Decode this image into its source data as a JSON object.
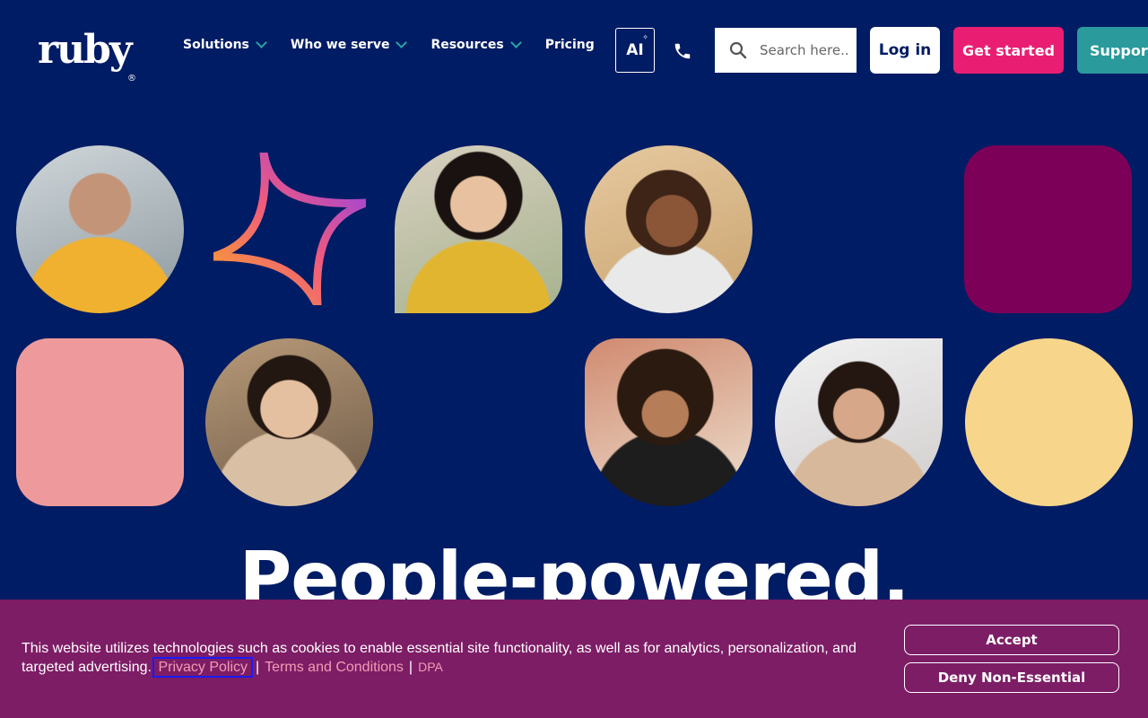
{
  "header": {
    "logo_text": "ruby",
    "logo_mark": "®",
    "nav": [
      {
        "label": "Solutions",
        "has_dropdown": true
      },
      {
        "label": "Who we serve",
        "has_dropdown": true
      },
      {
        "label": "Resources",
        "has_dropdown": true
      },
      {
        "label": "Pricing",
        "has_dropdown": false
      }
    ],
    "ai_label": "AI",
    "search_placeholder": "Search here...",
    "login_label": "Log in",
    "get_started_label": "Get started",
    "support_label": "Support"
  },
  "hero": {
    "headline": "People-powered."
  },
  "cookie_banner": {
    "text": "This website utilizes technologies such as cookies to enable essential site functionality, as well as for analytics, personalization, and targeted advertising.",
    "privacy_link": "Privacy Policy",
    "terms_link": "Terms and Conditions",
    "dpa_link": "DPA",
    "separator": "|",
    "accept_label": "Accept",
    "deny_label": "Deny Non-Essential"
  },
  "colors": {
    "background": "#001c64",
    "pink_cta": "#e91e73",
    "teal": "#2a9a9c",
    "banner": "#7d1d66",
    "tile_magenta": "#7d0058",
    "tile_pink": "#ee9a9c",
    "tile_yellow": "#f7d58b"
  },
  "icons": [
    "chevron-down-icon",
    "ai-sparkle-icon",
    "phone-icon",
    "search-icon",
    "sparkle-star-icon"
  ]
}
